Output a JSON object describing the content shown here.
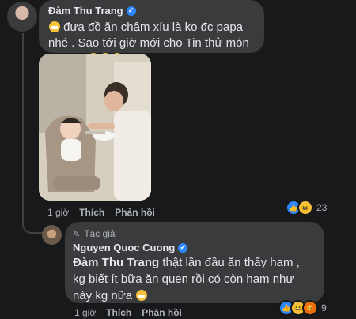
{
  "comment1": {
    "author": "Đàm Thu Trang",
    "text": "đưa đồ ăn chậm xíu là ko đc papa nhé . Sao tới giờ mới cho Tin thử món ăn này",
    "time": "1 giờ",
    "like_label": "Thích",
    "reply_label": "Phản hồi",
    "reaction_count": "23",
    "reaction_icons": [
      "like-icon",
      "haha-icon"
    ]
  },
  "reply1": {
    "badge": "Tác giả",
    "author": "Nguyen Quoc Cuong",
    "mention": "Đàm Thu Trang",
    "text": " thật lần đầu ăn thấy ham , kg biết ít bữa ăn quen rồi có còn ham như này kg nữa",
    "time": "1 giờ",
    "like_label": "Thích",
    "reply_label": "Phản hồi",
    "reaction_count": "9",
    "reaction_icons": [
      "like-icon",
      "haha-icon",
      "angry-icon"
    ]
  },
  "colors": {
    "background": "#18191a",
    "bubble": "#3a3b3c",
    "verified": "#2d88ff",
    "secondary_text": "#b0b3b8"
  }
}
